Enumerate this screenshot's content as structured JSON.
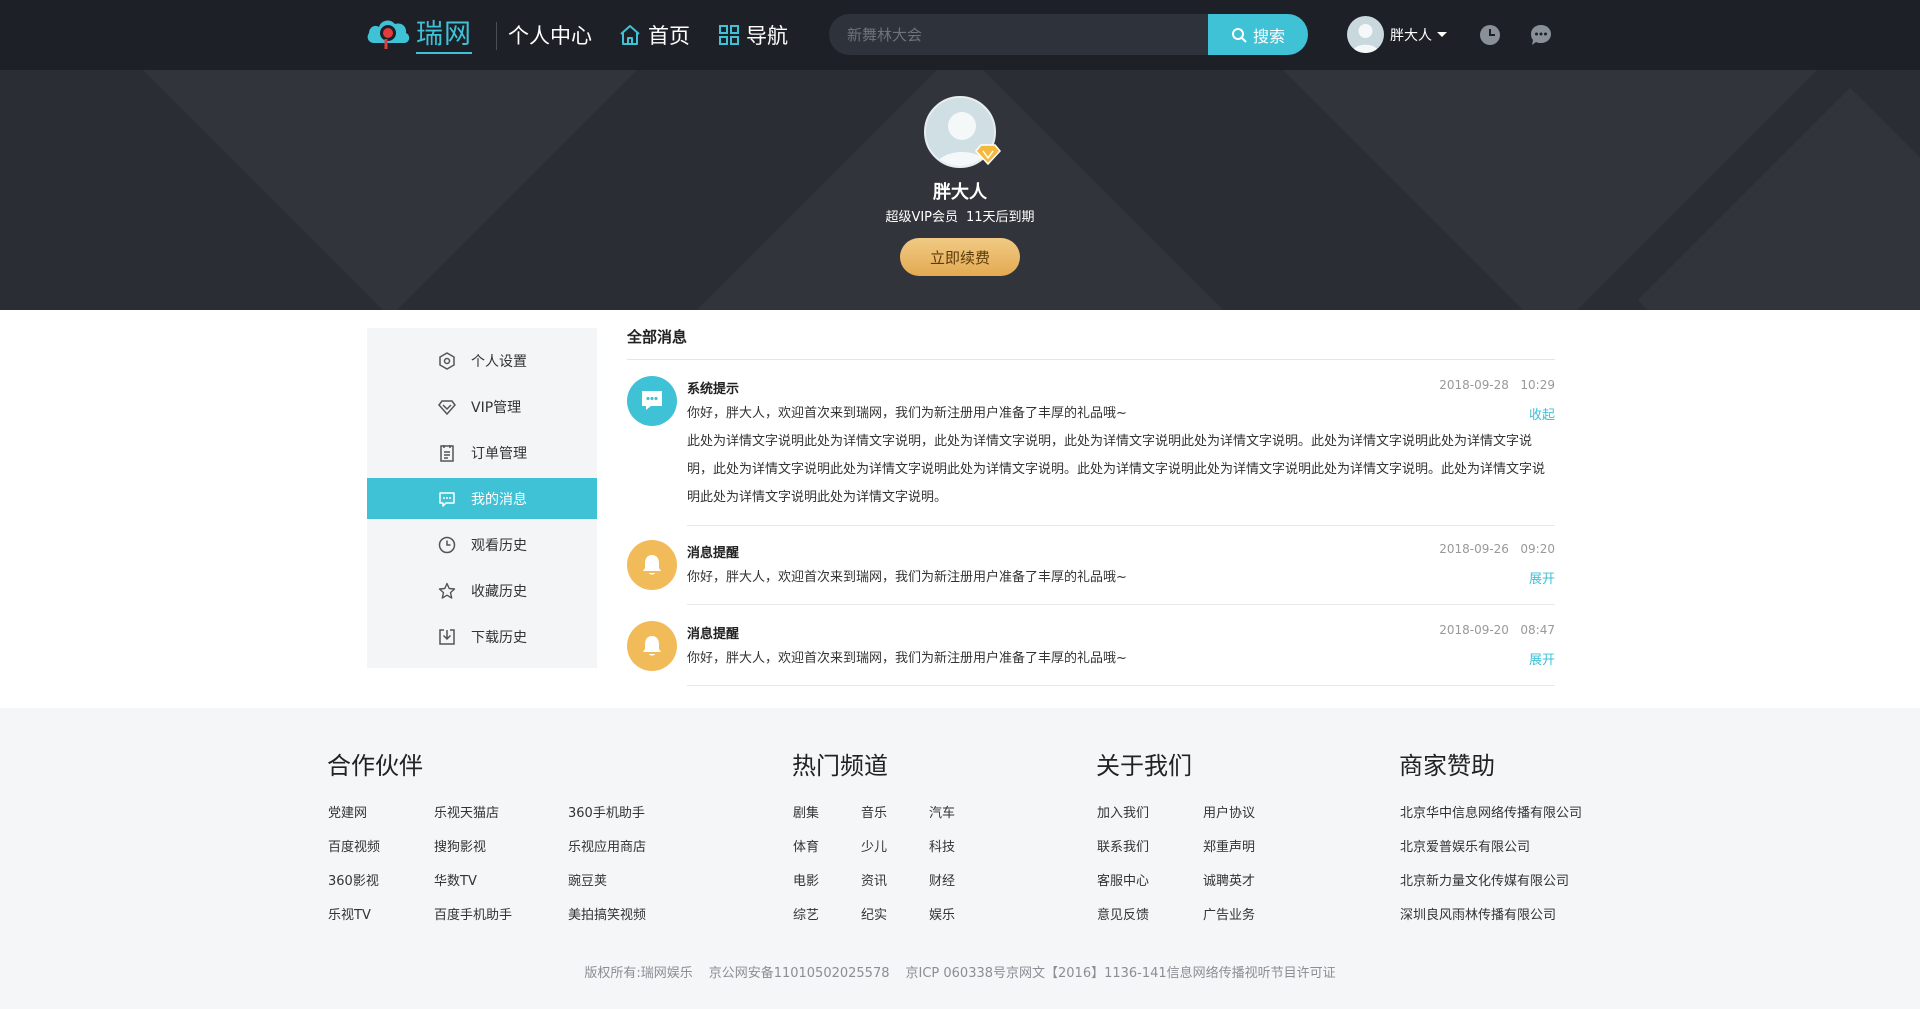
{
  "header": {
    "logo_text": "瑞网",
    "page_heading": "个人中心",
    "nav_home": "首页",
    "nav_guide": "导航",
    "search_placeholder": "新舞林大会",
    "search_button": "搜索",
    "user_name": "胖大人"
  },
  "profile": {
    "name": "胖大人",
    "membership": "超级VIP会员",
    "expiry": "11天后到期",
    "renew_button": "立即续费"
  },
  "sidebar": {
    "items": [
      {
        "label": "个人设置",
        "icon": "settings-icon"
      },
      {
        "label": "VIP管理",
        "icon": "vip-diamond-icon"
      },
      {
        "label": "订单管理",
        "icon": "order-icon"
      },
      {
        "label": "我的消息",
        "icon": "message-icon",
        "active": true
      },
      {
        "label": "观看历史",
        "icon": "clock-icon"
      },
      {
        "label": "收藏历史",
        "icon": "star-icon"
      },
      {
        "label": "下载历史",
        "icon": "download-icon"
      }
    ]
  },
  "messages": {
    "title": "全部消息",
    "items": [
      {
        "kind": "系统提示",
        "date": "2018-09-28",
        "time": "10:29",
        "text": "你好，胖大人，欢迎首次来到瑞网，我们为新注册用户准备了丰厚的礼品哦~",
        "toggle": "收起",
        "detail": "此处为详情文字说明此处为详情文字说明，此处为详情文字说明，此处为详情文字说明此处为详情文字说明。此处为详情文字说明此处为详情文字说明，此处为详情文字说明此处为详情文字说明此处为详情文字说明。此处为详情文字说明此处为详情文字说明此处为详情文字说明。此处为详情文字说明此处为详情文字说明此处为详情文字说明。",
        "color": "#3fc1d6",
        "icon": "chat-bubble-icon"
      },
      {
        "kind": "消息提醒",
        "date": "2018-09-26",
        "time": "09:20",
        "text": "你好，胖大人，欢迎首次来到瑞网，我们为新注册用户准备了丰厚的礼品哦~",
        "toggle": "展开",
        "color": "#f1bb5a",
        "icon": "bell-icon"
      },
      {
        "kind": "消息提醒",
        "date": "2018-09-20",
        "time": "08:47",
        "text": "你好，胖大人，欢迎首次来到瑞网，我们为新注册用户准备了丰厚的礼品哦~",
        "toggle": "展开",
        "color": "#f1bb5a",
        "icon": "bell-icon"
      }
    ]
  },
  "footer": {
    "partners": {
      "title": "合作伙伴",
      "links": [
        "党建网",
        "乐视天猫店",
        "360手机助手",
        "百度视频",
        "搜狗影视",
        "乐视应用商店",
        "360影视",
        "华数TV",
        "豌豆荚",
        "乐视TV",
        "百度手机助手",
        "美拍搞笑视频"
      ]
    },
    "channels": {
      "title": "热门频道",
      "links": [
        "剧集",
        "音乐",
        "汽车",
        "体育",
        "少儿",
        "科技",
        "电影",
        "资讯",
        "财经",
        "综艺",
        "纪实",
        "娱乐"
      ]
    },
    "about": {
      "title": "关于我们",
      "links": [
        "加入我们",
        "用户协议",
        "联系我们",
        "郑重声明",
        "客服中心",
        "诚聘英才",
        "意见反馈",
        "广告业务"
      ]
    },
    "sponsors": {
      "title": "商家赞助",
      "links": [
        "北京华中信息网络传播有限公司",
        "北京爱普娱乐有限公司",
        "北京新力量文化传媒有限公司",
        "深圳良风雨林传播有限公司"
      ]
    },
    "copyright": "版权所有:瑞网娱乐",
    "police_record": "京公网安备11010502025578",
    "icp": "京ICP 060338号京网文【2016】1136-141信息网络传播视听节目许可证"
  },
  "colors": {
    "accent": "#3fc1d6",
    "topbar": "#1d2127",
    "hero": "#2a2d33",
    "gold": "#e8b35e"
  }
}
